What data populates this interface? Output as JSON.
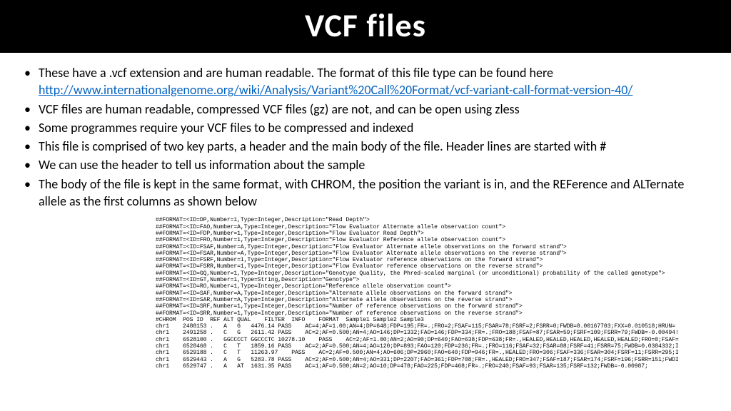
{
  "title": "VCF files",
  "bullets": [
    {
      "pre": "These have a .vcf extension and are human readable. The format of this file type can be found here ",
      "link": "http://www.internationalgenome.org/wiki/Analysis/Variant%20Call%20Format/vcf-variant-call-format-version-40/",
      "post": ""
    },
    {
      "pre": "VCF files are human readable, compressed VCF files (gz) are not, and can be open using zless",
      "link": "",
      "post": ""
    },
    {
      "pre": "Some programmes require your VCF files to be compressed and indexed",
      "link": "",
      "post": ""
    },
    {
      "pre": "This file is comprised of two key parts, a header and the main body of the file. Header lines are started with #",
      "link": "",
      "post": ""
    },
    {
      "pre": "We can use the header to tell us information about the sample",
      "link": "",
      "post": ""
    },
    {
      "pre": "The body of the file is kept in the same format, with CHROM, the position the variant is in, and the REFerence and ALTernate allele as the first columns as shown below",
      "link": "",
      "post": ""
    }
  ],
  "code": "##FORMAT=<ID=DP,Number=1,Type=Integer,Description=\"Read Depth\">\n##FORMAT=<ID=FAO,Number=A,Type=Integer,Description=\"Flow Evaluator Alternate allele observation count\">\n##FORMAT=<ID=FDP,Number=1,Type=Integer,Description=\"Flow Evaluator Read Depth\">\n##FORMAT=<ID=FRO,Number=1,Type=Integer,Description=\"Flow Evaluator Reference allele observation count\">\n##FORMAT=<ID=FSAF,Number=A,Type=Integer,Description=\"Flow Evaluator Alternate allele observations on the forward strand\">\n##FORMAT=<ID=FSAR,Number=A,Type=Integer,Description=\"Flow Evaluator Alternate allele observations on the reverse strand\">\n##FORMAT=<ID=FSRF,Number=1,Type=Integer,Description=\"Flow Evaluator reference observations on the forward strand\">\n##FORMAT=<ID=FSRR,Number=1,Type=Integer,Description=\"Flow Evaluator reference observations on the reverse strand\">\n##FORMAT=<ID=GQ,Number=1,Type=Integer,Description=\"Genotype Quality, the Phred-scaled marginal (or unconditional) probability of the called genotype\">\n##FORMAT=<ID=GT,Number=1,Type=String,Description=\"Genotype\">\n##FORMAT=<ID=RO,Number=1,Type=Integer,Description=\"Reference allele observation count\">\n##FORMAT=<ID=SAF,Number=A,Type=Integer,Description=\"Alternate allele observations on the forward strand\">\n##FORMAT=<ID=SAR,Number=A,Type=Integer,Description=\"Alternate allele observations on the reverse strand\">\n##FORMAT=<ID=SRF,Number=1,Type=Integer,Description=\"Number of reference observations on the forward strand\">\n##FORMAT=<ID=SRR,Number=1,Type=Integer,Description=\"Number of reference observations on the reverse strand\">\n#CHROM  POS ID  REF ALT QUAL    FILTER  INFO    FORMAT  Sample1 Sample2 Sample3\nchr1    2488153 .   A   G   4476.14 PASS    AC=4;AF=1.00;AN=4;DP=648;FDP=195;FR=.;FRO=2;FSAF=115;FSAR=78;FSRF=2;FSRR=0;FWDB=0.00167703;FXX=0.010518;HRUN=\nchr1    2491258 .   C   G   2611.42 PASS    AC=2;AF=0.500;AN=4;AO=146;DP=1332;FAO=146;FDP=334;FR=.;FRO=188;FSAF=87;FSAR=59;FSRF=109;FSRR=79;FWDB=-0.00494!\nchr1    6528100 .   GGCCCCT GGCCCTC 10278.10    PASS    AC=2;AF=1.00;AN=2;AO=90;DP=640;FAO=638;FDP=638;FR=.,HEALED,HEALED,HEALED,HEALED,HEALED;FRO=0;FSAF=\nchr1    6528468 .   C   T   1859.16 PASS    AC=2;AF=0.500;AN=4;AO=120;DP=893;FAO=120;FDP=236;FR=.;FRO=116;FSAF=32;FSAR=88;FSRF=41;FSRR=75;FWDB=0.0384332;I\nchr1    6529188 .   C   T   11263.97    PASS    AC=2;AF=0.500;AN=4;AO=606;DP=2960;FAO=640;FDP=946;FR=.,HEALED;FRO=306;FSAF=336;FSAR=304;FSRF=11;FSRR=295;I\nchr1    6529443 .   A   G   5283.78 PASS    AC=2;AF=0.500;AN=4;AO=331;DP=2207;FAO=361;FDP=708;FR=.,HEALED;FRO=347;FSAF=187;FSAR=174;FSRF=196;FSRR=151;FWDI\nchr1    6529747 .   A   AT  1631.35 PASS    AC=1;AF=0.500;AN=2;AO=10;DP=478;FAO=225;FDP=468;FR=.;FRO=240;FSAF=93;FSAR=135;FSRF=132;FWDB=-0.00987;"
}
